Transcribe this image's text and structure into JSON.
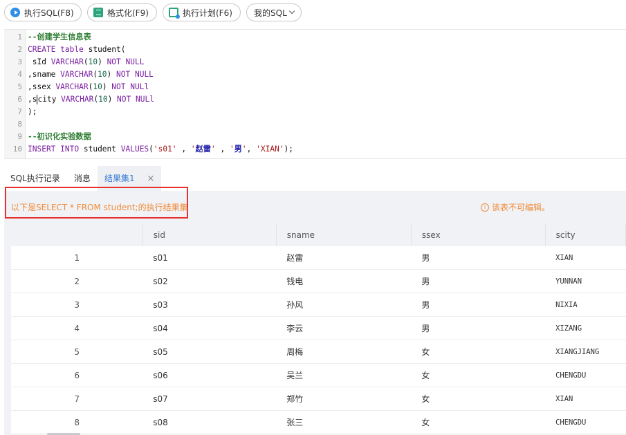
{
  "toolbar": {
    "run": "执行SQL(F8)",
    "format": "格式化(F9)",
    "plan": "执行计划(F6)",
    "my_sql": "我的SQL"
  },
  "editor": {
    "lines": [
      {
        "n": "1",
        "tokens": [
          {
            "c": "cm",
            "t": "--创建学生信息表"
          }
        ]
      },
      {
        "n": "2",
        "tokens": [
          {
            "c": "kw",
            "t": "CREATE"
          },
          {
            "c": "id",
            "t": " "
          },
          {
            "c": "kw",
            "t": "table"
          },
          {
            "c": "id",
            "t": " student("
          }
        ]
      },
      {
        "n": "3",
        "tokens": [
          {
            "c": "id",
            "t": " sId "
          },
          {
            "c": "kw",
            "t": "VARCHAR"
          },
          {
            "c": "id",
            "t": "("
          },
          {
            "c": "num",
            "t": "10"
          },
          {
            "c": "id",
            "t": ") "
          },
          {
            "c": "kw",
            "t": "NOT NULL"
          }
        ]
      },
      {
        "n": "4",
        "tokens": [
          {
            "c": "id",
            "t": ",sname "
          },
          {
            "c": "kw",
            "t": "VARCHAR"
          },
          {
            "c": "id",
            "t": "("
          },
          {
            "c": "num",
            "t": "10"
          },
          {
            "c": "id",
            "t": ") "
          },
          {
            "c": "kw",
            "t": "NOT NULL"
          }
        ]
      },
      {
        "n": "5",
        "tokens": [
          {
            "c": "id",
            "t": ",ssex "
          },
          {
            "c": "kw",
            "t": "VARCHAR"
          },
          {
            "c": "id",
            "t": "("
          },
          {
            "c": "num",
            "t": "10"
          },
          {
            "c": "id",
            "t": ") "
          },
          {
            "c": "kw",
            "t": "NOT NULl"
          }
        ]
      },
      {
        "n": "6",
        "tokens": [
          {
            "c": "id",
            "t": ",s"
          },
          {
            "c": "caret",
            "t": ""
          },
          {
            "c": "id",
            "t": "city "
          },
          {
            "c": "kw",
            "t": "VARCHAR"
          },
          {
            "c": "id",
            "t": "("
          },
          {
            "c": "num",
            "t": "10"
          },
          {
            "c": "id",
            "t": ") "
          },
          {
            "c": "kw",
            "t": "NOT NULl"
          }
        ]
      },
      {
        "n": "7",
        "tokens": [
          {
            "c": "id",
            "t": ");"
          }
        ]
      },
      {
        "n": "8",
        "tokens": []
      },
      {
        "n": "9",
        "tokens": [
          {
            "c": "cm",
            "t": "--初识化实验数据"
          }
        ]
      },
      {
        "n": "10",
        "tokens": [
          {
            "c": "kw",
            "t": "INSERT"
          },
          {
            "c": "id",
            "t": " "
          },
          {
            "c": "kw",
            "t": "INTO"
          },
          {
            "c": "id",
            "t": " student "
          },
          {
            "c": "kw",
            "t": "VALUES"
          },
          {
            "c": "id",
            "t": "("
          },
          {
            "c": "str",
            "t": "'s01'"
          },
          {
            "c": "id",
            "t": " , "
          },
          {
            "c": "str",
            "t": "'"
          },
          {
            "c": "cn",
            "t": "赵雷"
          },
          {
            "c": "str",
            "t": "'"
          },
          {
            "c": "id",
            "t": " , "
          },
          {
            "c": "str",
            "t": "'"
          },
          {
            "c": "cn",
            "t": "男"
          },
          {
            "c": "str",
            "t": "'"
          },
          {
            "c": "id",
            "t": ", "
          },
          {
            "c": "str",
            "t": "'XIAN'"
          },
          {
            "c": "id",
            "t": ");"
          }
        ]
      }
    ]
  },
  "tabs": {
    "history": "SQL执行记录",
    "messages": "消息",
    "result": "结果集1",
    "close": "×"
  },
  "result": {
    "info": "以下是SELECT * FROM student;的执行结果集",
    "readonly": "该表不可编辑。",
    "columns": [
      "",
      "sid",
      "sname",
      "ssex",
      "scity"
    ],
    "rows": [
      [
        "1",
        "s01",
        "赵雷",
        "男",
        "XIAN"
      ],
      [
        "2",
        "s02",
        "钱电",
        "男",
        "YUNNAN"
      ],
      [
        "3",
        "s03",
        "孙风",
        "男",
        "NIXIA"
      ],
      [
        "4",
        "s04",
        "李云",
        "男",
        "XIZANG"
      ],
      [
        "5",
        "s05",
        "周梅",
        "女",
        "XIANGJIANG"
      ],
      [
        "6",
        "s06",
        "吴兰",
        "女",
        "CHENGDU"
      ],
      [
        "7",
        "s07",
        "郑竹",
        "女",
        "XIAN"
      ],
      [
        "8",
        "s08",
        "张三",
        "女",
        "CHENGDU"
      ]
    ]
  },
  "colors": {
    "accent": "#3a7bd5",
    "warning": "#f08c3c",
    "highlight_box": "#e8302f"
  }
}
